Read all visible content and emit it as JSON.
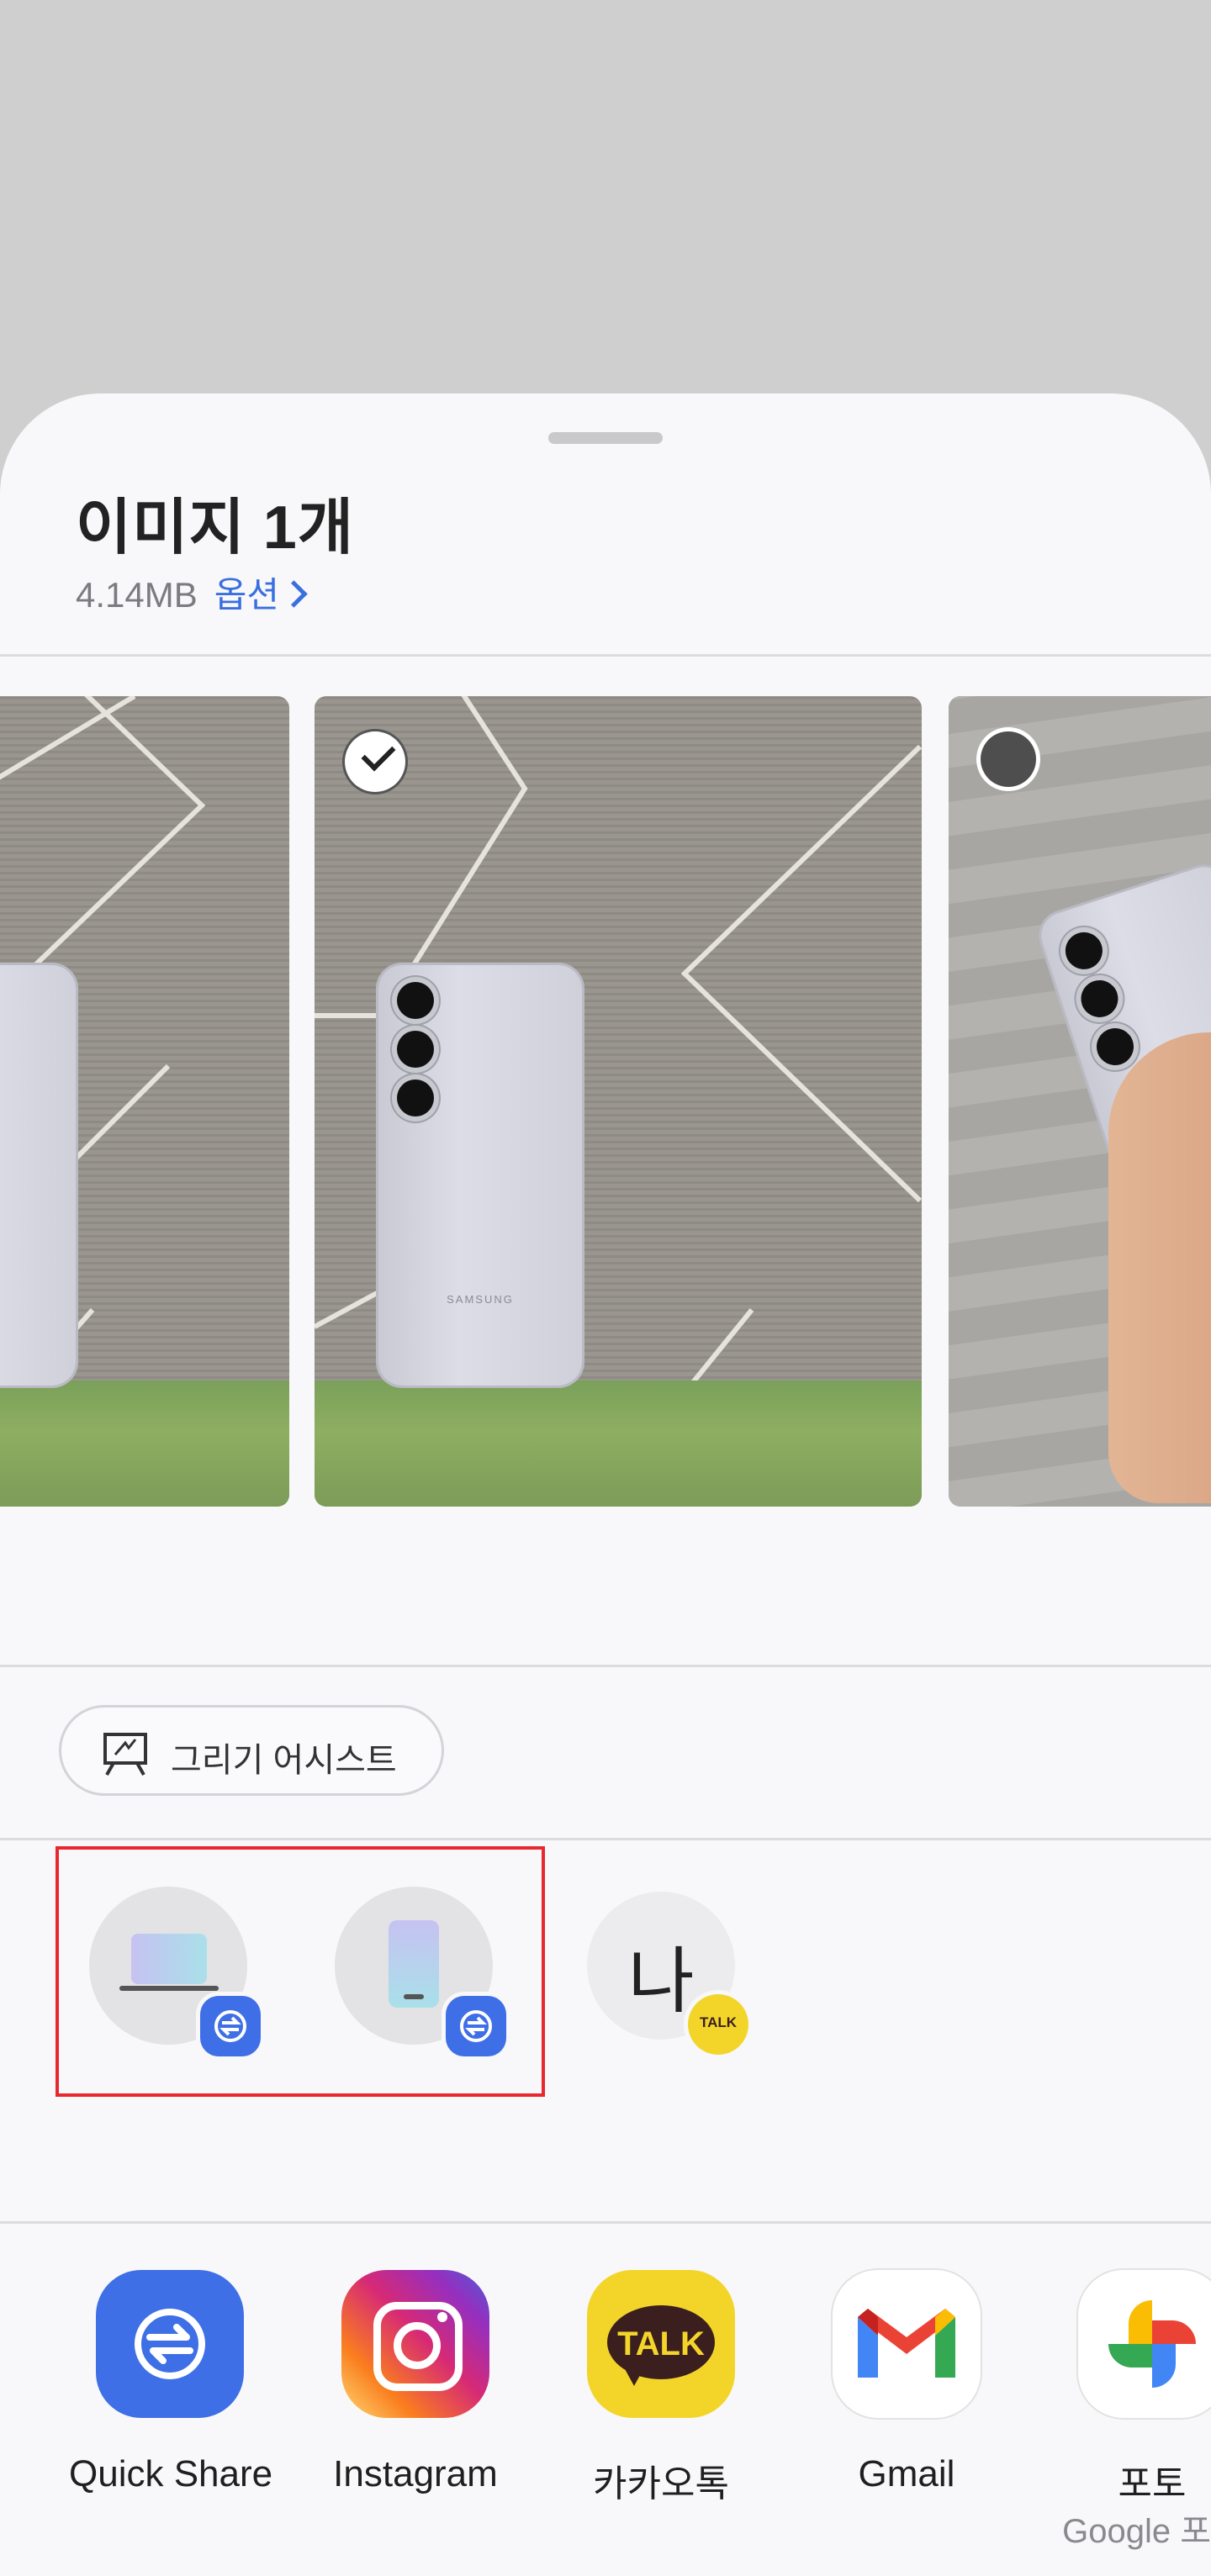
{
  "sheet": {
    "title": "이미지 1개",
    "size": "4.14MB",
    "options_label": "옵션"
  },
  "gallery": {
    "items": [
      {
        "label": "image-left",
        "selected": false
      },
      {
        "label": "image-center",
        "selected": true
      },
      {
        "label": "image-right",
        "selected": false
      }
    ],
    "phone_brand": "SAMSUNG"
  },
  "assist_chip": {
    "label": "그리기 어시스트",
    "icon": "drawing-easel-icon"
  },
  "nearby": {
    "devices": [
      {
        "name": "laptop-device",
        "badge": "quick-share-icon"
      },
      {
        "name": "tablet-device",
        "badge": "quick-share-icon"
      }
    ],
    "contact": {
      "label": "나",
      "badge": "TALK"
    }
  },
  "apps": [
    {
      "label": "Quick Share",
      "sub": ""
    },
    {
      "label": "Instagram",
      "sub": ""
    },
    {
      "label": "카카오톡",
      "sub": ""
    },
    {
      "label": "Gmail",
      "sub": ""
    },
    {
      "label": "포토",
      "sub": "Google 포토"
    }
  ],
  "colors": {
    "accent": "#3a6fe0",
    "highlight": "#e8282e",
    "quickshare": "#3f6fe6",
    "kakao": "#f3d52a"
  }
}
